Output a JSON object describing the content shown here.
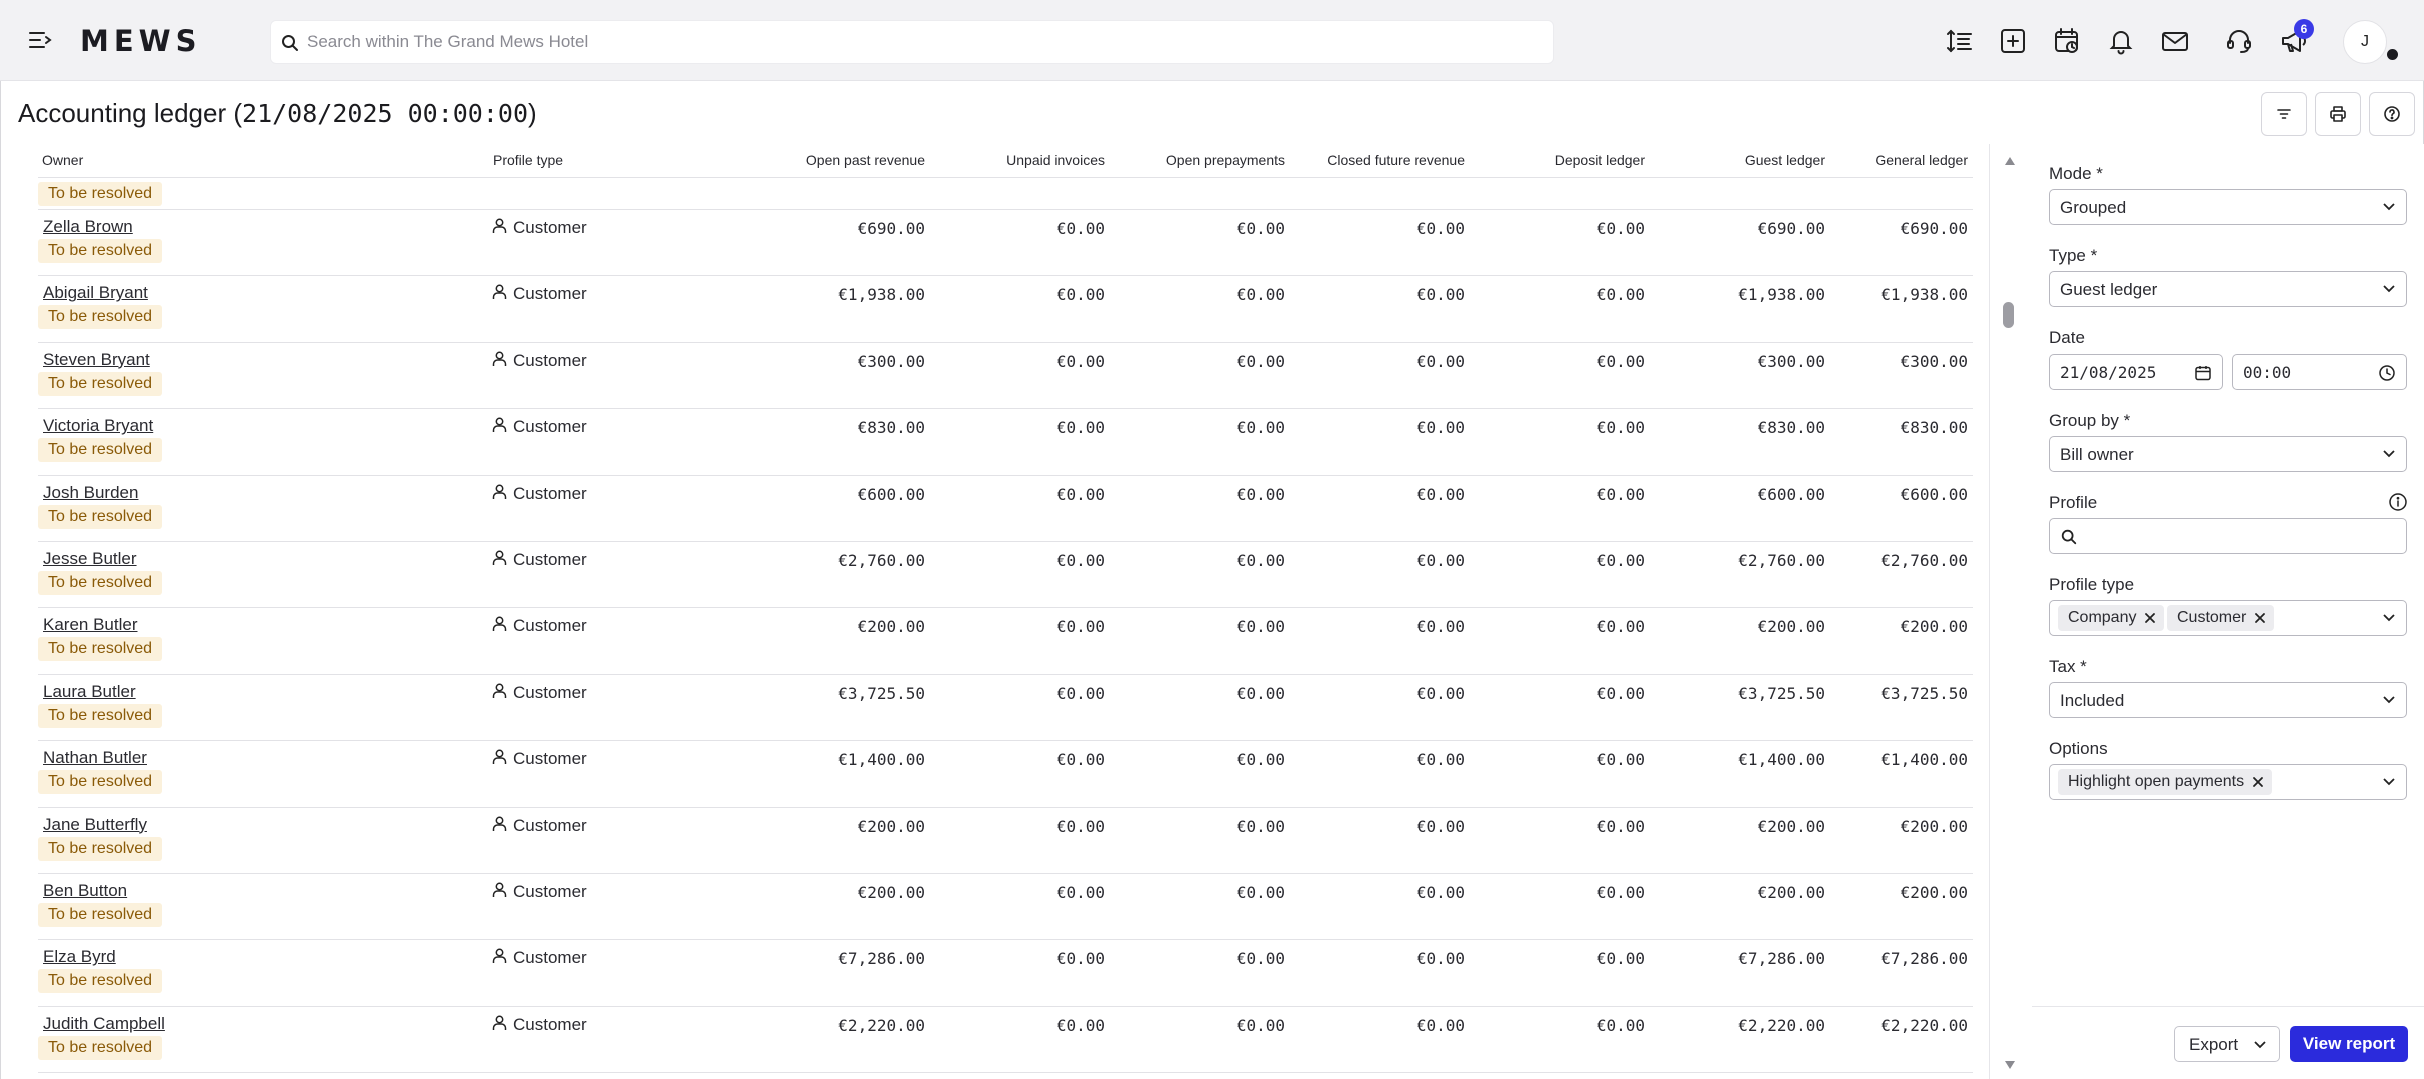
{
  "app": {
    "logo": "MEWS",
    "search_placeholder": "Search within The Grand Mews Hotel",
    "notifications_count": "6",
    "avatar_initial": "J"
  },
  "page": {
    "title_text": "Accounting ledger (",
    "title_datetime": "21/08/2025 00:00:00",
    "title_close": ")"
  },
  "table": {
    "columns": [
      "Owner",
      "Profile type",
      "Open past revenue",
      "Unpaid invoices",
      "Open prepayments",
      "Closed future revenue",
      "Deposit ledger",
      "Guest ledger",
      "General ledger"
    ],
    "partial_badge": "To be resolved",
    "rows": [
      {
        "owner": "Zella Brown",
        "badge": "To be resolved",
        "ptype": "Customer",
        "v": [
          "€690.00",
          "€0.00",
          "€0.00",
          "€0.00",
          "€0.00",
          "€690.00",
          "€690.00"
        ]
      },
      {
        "owner": "Abigail Bryant",
        "badge": "To be resolved",
        "ptype": "Customer",
        "v": [
          "€1,938.00",
          "€0.00",
          "€0.00",
          "€0.00",
          "€0.00",
          "€1,938.00",
          "€1,938.00"
        ]
      },
      {
        "owner": "Steven Bryant",
        "badge": "To be resolved",
        "ptype": "Customer",
        "v": [
          "€300.00",
          "€0.00",
          "€0.00",
          "€0.00",
          "€0.00",
          "€300.00",
          "€300.00"
        ]
      },
      {
        "owner": "Victoria Bryant",
        "badge": "To be resolved",
        "ptype": "Customer",
        "v": [
          "€830.00",
          "€0.00",
          "€0.00",
          "€0.00",
          "€0.00",
          "€830.00",
          "€830.00"
        ]
      },
      {
        "owner": "Josh Burden",
        "badge": "To be resolved",
        "ptype": "Customer",
        "v": [
          "€600.00",
          "€0.00",
          "€0.00",
          "€0.00",
          "€0.00",
          "€600.00",
          "€600.00"
        ]
      },
      {
        "owner": "Jesse Butler",
        "badge": "To be resolved",
        "ptype": "Customer",
        "v": [
          "€2,760.00",
          "€0.00",
          "€0.00",
          "€0.00",
          "€0.00",
          "€2,760.00",
          "€2,760.00"
        ]
      },
      {
        "owner": "Karen Butler",
        "badge": "To be resolved",
        "ptype": "Customer",
        "v": [
          "€200.00",
          "€0.00",
          "€0.00",
          "€0.00",
          "€0.00",
          "€200.00",
          "€200.00"
        ]
      },
      {
        "owner": "Laura Butler",
        "badge": "To be resolved",
        "ptype": "Customer",
        "v": [
          "€3,725.50",
          "€0.00",
          "€0.00",
          "€0.00",
          "€0.00",
          "€3,725.50",
          "€3,725.50"
        ]
      },
      {
        "owner": "Nathan Butler",
        "badge": "To be resolved",
        "ptype": "Customer",
        "v": [
          "€1,400.00",
          "€0.00",
          "€0.00",
          "€0.00",
          "€0.00",
          "€1,400.00",
          "€1,400.00"
        ]
      },
      {
        "owner": "Jane Butterfly",
        "badge": "To be resolved",
        "ptype": "Customer",
        "v": [
          "€200.00",
          "€0.00",
          "€0.00",
          "€0.00",
          "€0.00",
          "€200.00",
          "€200.00"
        ]
      },
      {
        "owner": "Ben Button",
        "badge": "To be resolved",
        "ptype": "Customer",
        "v": [
          "€200.00",
          "€0.00",
          "€0.00",
          "€0.00",
          "€0.00",
          "€200.00",
          "€200.00"
        ]
      },
      {
        "owner": "Elza Byrd",
        "badge": "To be resolved",
        "ptype": "Customer",
        "v": [
          "€7,286.00",
          "€0.00",
          "€0.00",
          "€0.00",
          "€0.00",
          "€7,286.00",
          "€7,286.00"
        ]
      },
      {
        "owner": "Judith Campbell",
        "badge": "To be resolved",
        "ptype": "Customer",
        "v": [
          "€2,220.00",
          "€0.00",
          "€0.00",
          "€0.00",
          "€0.00",
          "€2,220.00",
          "€2,220.00"
        ]
      }
    ]
  },
  "filters": {
    "mode": {
      "label": "Mode *",
      "value": "Grouped"
    },
    "type": {
      "label": "Type *",
      "value": "Guest ledger"
    },
    "date": {
      "label": "Date",
      "date_value": "21/08/2025",
      "time_value": "00:00"
    },
    "group_by": {
      "label": "Group by *",
      "value": "Bill owner"
    },
    "profile": {
      "label": "Profile",
      "value": ""
    },
    "profile_type": {
      "label": "Profile type",
      "chips": [
        "Company",
        "Customer"
      ]
    },
    "tax": {
      "label": "Tax *",
      "value": "Included"
    },
    "options": {
      "label": "Options",
      "chips": [
        "Highlight open payments"
      ]
    }
  },
  "actions": {
    "export": "Export",
    "view_report": "View report"
  },
  "colors": {
    "accent": "#2b2bdc",
    "badge_bg": "#fbf1dc",
    "badge_text": "#8a5a08"
  }
}
